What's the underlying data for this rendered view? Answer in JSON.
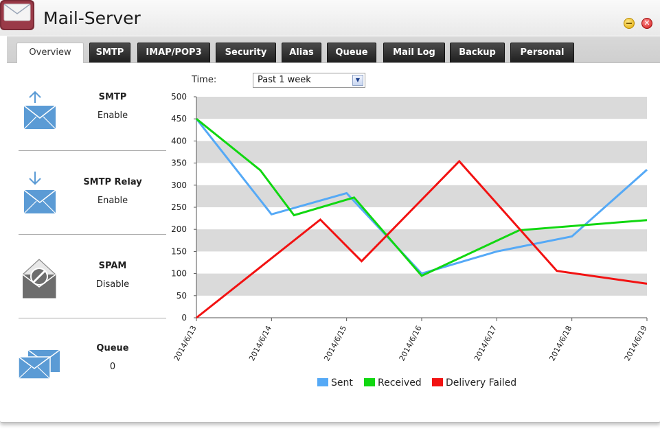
{
  "window": {
    "title": "Mail-Server"
  },
  "tabs": [
    {
      "label": "Overview",
      "active": true
    },
    {
      "label": "SMTP",
      "active": false
    },
    {
      "label": "IMAP/POP3",
      "active": false
    },
    {
      "label": "Security",
      "active": false
    },
    {
      "label": "Alias",
      "active": false
    },
    {
      "label": "Queue",
      "active": false
    },
    {
      "label": "Mail Log",
      "active": false
    },
    {
      "label": "Backup",
      "active": false
    },
    {
      "label": "Personal",
      "active": false
    }
  ],
  "filter": {
    "label": "Time:",
    "selected": "Past 1 week"
  },
  "services": [
    {
      "title": "SMTP",
      "value": "Enable",
      "icon": "mail-outgoing-icon"
    },
    {
      "title": "SMTP Relay",
      "value": "Enable",
      "icon": "mail-incoming-icon"
    },
    {
      "title": "SPAM",
      "value": "Disable",
      "icon": "spam-filter-icon"
    },
    {
      "title": "Queue",
      "value": "0",
      "icon": "mail-queue-icon"
    }
  ],
  "colors": {
    "sent": "#55a9f6",
    "received": "#11d711",
    "failed": "#f21212",
    "band": "#dadada",
    "icon": "#5b9bd5"
  },
  "chart_data": {
    "type": "line",
    "title": "",
    "xlabel": "",
    "ylabel": "",
    "ylim": [
      0,
      500
    ],
    "yticks": [
      0,
      50,
      100,
      150,
      200,
      250,
      300,
      350,
      400,
      450,
      500
    ],
    "x_ticks": [
      "2014/6/13",
      "2014/6/14",
      "2014/6/15",
      "2014/6/16",
      "2014/6/17",
      "2014/6/18",
      "2014/6/19"
    ],
    "legend_position": "bottom",
    "series": [
      {
        "name": "Sent",
        "color": "#55a9f6",
        "points": [
          [
            0,
            450
          ],
          [
            1,
            234
          ],
          [
            2,
            282
          ],
          [
            3,
            100
          ],
          [
            4,
            150
          ],
          [
            5,
            184
          ],
          [
            6,
            335
          ]
        ]
      },
      {
        "name": "Received",
        "color": "#11d711",
        "points": [
          [
            0,
            450
          ],
          [
            0.85,
            334
          ],
          [
            1.3,
            232
          ],
          [
            2.1,
            272
          ],
          [
            3,
            95
          ],
          [
            4.3,
            198
          ],
          [
            6,
            221
          ]
        ]
      },
      {
        "name": "Delivery Failed",
        "color": "#f21212",
        "points": [
          [
            0,
            0
          ],
          [
            1.65,
            222
          ],
          [
            2.2,
            128
          ],
          [
            3.5,
            354
          ],
          [
            4.8,
            106
          ],
          [
            6,
            77
          ]
        ]
      }
    ]
  }
}
